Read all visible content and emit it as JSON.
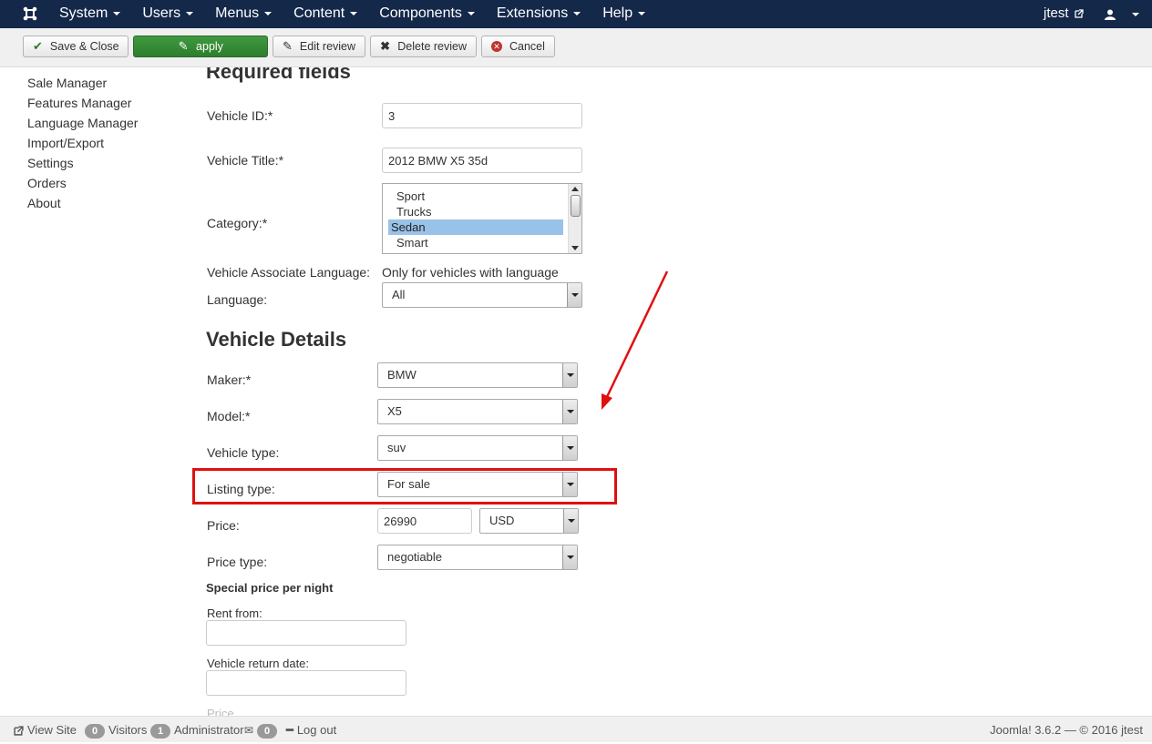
{
  "navbar": {
    "menu": [
      "System",
      "Users",
      "Menus",
      "Content",
      "Components",
      "Extensions",
      "Help"
    ],
    "user": "jtest"
  },
  "toolbar": {
    "save_close": "Save & Close",
    "apply": "apply",
    "edit_review": "Edit review",
    "delete_review": "Delete review",
    "cancel": "Cancel"
  },
  "sidebar": {
    "items": [
      "Sale Manager",
      "Features Manager",
      "Language Manager",
      "Import/Export",
      "Settings",
      "Orders",
      "About"
    ]
  },
  "form": {
    "required_heading": "Required fields",
    "vehicle_id_label": "Vehicle ID:*",
    "vehicle_id_value": "3",
    "vehicle_title_label": "Vehicle Title:*",
    "vehicle_title_value": "2012 BMW X5 35d",
    "category_label": "Category:*",
    "category_options": [
      "Sport",
      "Trucks",
      "Sedan",
      "Smart"
    ],
    "category_selected": "Sedan",
    "assoc_lang_label": "Vehicle Associate Language:",
    "assoc_lang_note": "Only for vehicles with language",
    "language_label": "Language:",
    "language_value": "All",
    "details_heading": "Vehicle Details",
    "maker_label": "Maker:*",
    "maker_value": "BMW",
    "model_label": "Model:*",
    "model_value": "X5",
    "vehicle_type_label": "Vehicle type:",
    "vehicle_type_value": "suv",
    "listing_type_label": "Listing type:",
    "listing_type_value": "For sale",
    "price_label": "Price:",
    "price_value": "26990",
    "currency_value": "USD",
    "price_type_label": "Price type:",
    "price_type_value": "negotiable",
    "special_heading": "Special price per night",
    "rent_from_label": "Rent from:",
    "return_date_label": "Vehicle return date:",
    "price_partial_label": "Price"
  },
  "statusbar": {
    "view_site": "View Site",
    "visitors_count": "0",
    "visitors_label": "Visitors",
    "admin_count": "1",
    "admin_label": "Administrator",
    "messages_count": "0",
    "logout": "Log out",
    "version": "Joomla! 3.6.2 — © 2016 jtest"
  },
  "colors": {
    "navbar_bg": "#142849",
    "apply_green": "#3f9a3f",
    "highlight_red": "#e01010",
    "selected_option": "#99c2e8"
  }
}
